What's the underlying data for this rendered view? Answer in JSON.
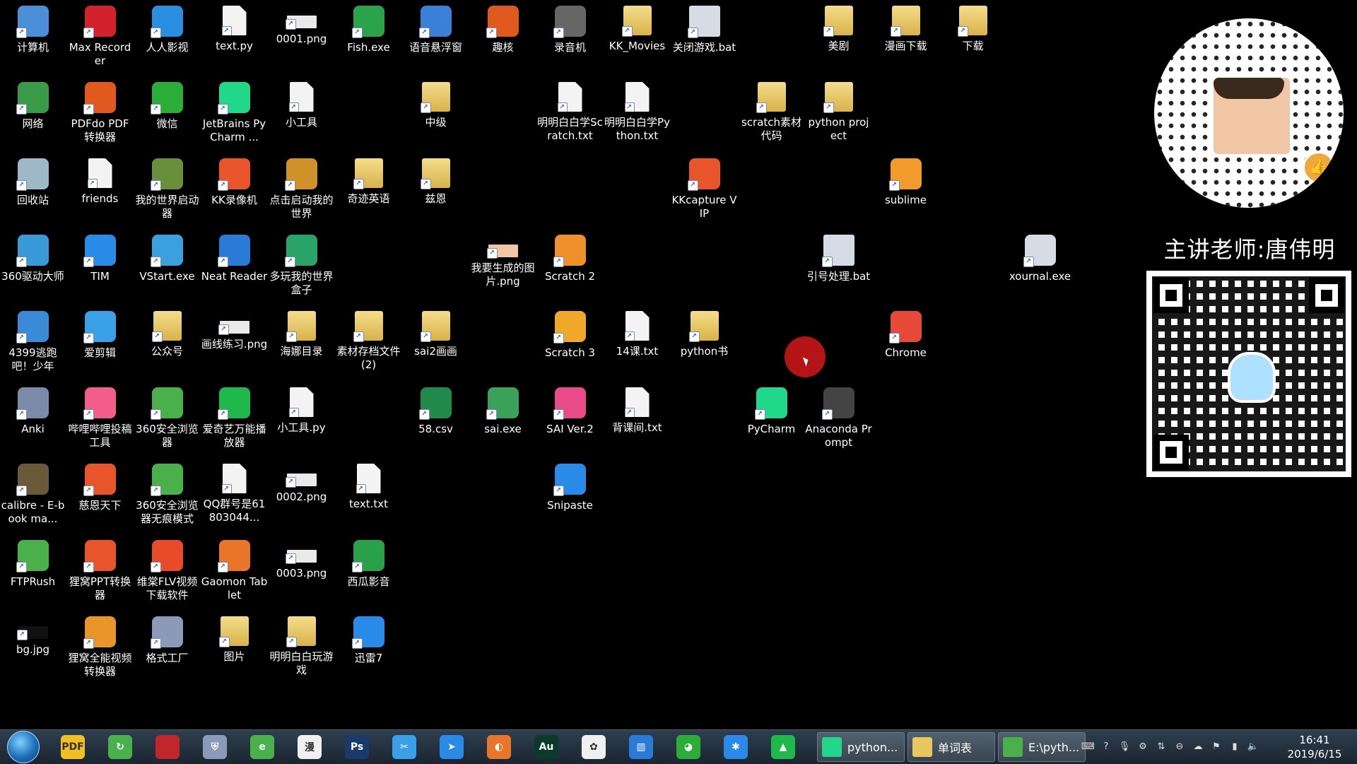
{
  "desktop": {
    "icons": [
      {
        "label": "计算机",
        "icon": "computer-icon",
        "color": "#4a8fd8"
      },
      {
        "label": "Max Recorder",
        "icon": "record-icon",
        "color": "#d2232a"
      },
      {
        "label": "人人影视",
        "icon": "video-icon",
        "color": "#2a8fe0"
      },
      {
        "label": "text.py",
        "icon": "python-file-icon",
        "color": "#f0f0f0"
      },
      {
        "label": "0001.png",
        "icon": "image-file-icon",
        "color": "#eaeaea"
      },
      {
        "label": "Fish.exe",
        "icon": "fish-icon",
        "color": "#2aa34a"
      },
      {
        "label": "语音悬浮窗",
        "icon": "voice-icon",
        "color": "#3a7fd8"
      },
      {
        "label": "趣核",
        "icon": "app-icon",
        "color": "#e05a20"
      },
      {
        "label": "录音机",
        "icon": "microphone-icon",
        "color": "#666666"
      },
      {
        "label": "KK_Movies",
        "icon": "folder-icon",
        "color": "#e8c660"
      },
      {
        "label": "关闭游戏.bat",
        "icon": "batch-file-icon",
        "color": "#d5dce6"
      },
      {
        "label": "美剧",
        "icon": "folder-icon",
        "color": "#e8c660"
      },
      {
        "label": "漫画下载",
        "icon": "folder-icon",
        "color": "#e8c660"
      },
      {
        "label": "下载",
        "icon": "folder-icon",
        "color": "#e8c660"
      },
      {
        "label": "网络",
        "icon": "network-icon",
        "color": "#3a9a4a"
      },
      {
        "label": "PDFdo PDF转换器",
        "icon": "pdf-icon",
        "color": "#e05a20"
      },
      {
        "label": "微信",
        "icon": "wechat-icon",
        "color": "#2aae38"
      },
      {
        "label": "JetBrains PyCharm ...",
        "icon": "pycharm-icon",
        "color": "#21d789"
      },
      {
        "label": "小工具",
        "icon": "file-icon",
        "color": "#f0f0f0"
      },
      {
        "label": "中级",
        "icon": "folder-icon",
        "color": "#e8c660"
      },
      {
        "label": "明明白白学Scratch.txt",
        "icon": "text-file-icon",
        "color": "#f0f0f0"
      },
      {
        "label": "明明白白学Python.txt",
        "icon": "text-file-icon",
        "color": "#f0f0f0"
      },
      {
        "label": "scratch素材代码",
        "icon": "folder-icon",
        "color": "#e8c660"
      },
      {
        "label": "python project",
        "icon": "folder-icon",
        "color": "#e8c660"
      },
      {
        "label": "回收站",
        "icon": "recycle-bin-icon",
        "color": "#9fb8c8"
      },
      {
        "label": "friends",
        "icon": "file-icon",
        "color": "#f0f0f0"
      },
      {
        "label": "我的世界启动器",
        "icon": "minecraft-icon",
        "color": "#6a8f3a"
      },
      {
        "label": "KK录像机",
        "icon": "kk-recorder-icon",
        "color": "#e8552a"
      },
      {
        "label": "点击启动我的世界",
        "icon": "minecraft-house-icon",
        "color": "#d0902a"
      },
      {
        "label": "奇迹英语",
        "icon": "folder-icon",
        "color": "#e8c660"
      },
      {
        "label": "兹恩",
        "icon": "folder-icon",
        "color": "#e8c660"
      },
      {
        "label": "KKcapture VIP",
        "icon": "kk-recorder-icon",
        "color": "#e8552a"
      },
      {
        "label": "sublime",
        "icon": "sublime-icon",
        "color": "#f29a2a"
      },
      {
        "label": "360驱动大师",
        "icon": "driver-icon",
        "color": "#3a9ad8"
      },
      {
        "label": "TIM",
        "icon": "tim-icon",
        "color": "#2a8ae8"
      },
      {
        "label": "VStart.exe",
        "icon": "vstart-icon",
        "color": "#3aa0e0"
      },
      {
        "label": "Neat Reader",
        "icon": "book-icon",
        "color": "#2a7ad8"
      },
      {
        "label": "多玩我的世界盒子",
        "icon": "box-icon",
        "color": "#2aa36a"
      },
      {
        "label": "我要生成的图片.png",
        "icon": "image-file-icon",
        "color": "#f1c6a4"
      },
      {
        "label": "Scratch 2",
        "icon": "scratch-cat-icon",
        "color": "#f0902a"
      },
      {
        "label": "引号处理.bat",
        "icon": "batch-file-icon",
        "color": "#d5dce6"
      },
      {
        "label": "xournal.exe",
        "icon": "xournal-icon",
        "color": "#d5dce6"
      },
      {
        "label": "4399逃跑吧！少年",
        "icon": "game-icon",
        "color": "#3a8ad8"
      },
      {
        "label": "爱剪辑",
        "icon": "video-edit-icon",
        "color": "#3aa0e8"
      },
      {
        "label": "公众号",
        "icon": "folder-icon",
        "color": "#e8c660"
      },
      {
        "label": "画线练习.png",
        "icon": "image-file-icon",
        "color": "#eaeaea"
      },
      {
        "label": "海娜目录",
        "icon": "folder-icon",
        "color": "#e8c660"
      },
      {
        "label": "素材存档文件(2)",
        "icon": "folder-icon",
        "color": "#e8c660"
      },
      {
        "label": "sai2画画",
        "icon": "folder-icon",
        "color": "#e8c660"
      },
      {
        "label": "Scratch 3",
        "icon": "scratch-icon",
        "color": "#f0a82a"
      },
      {
        "label": "14课.txt",
        "icon": "text-file-icon",
        "color": "#f0f0f0"
      },
      {
        "label": "python书",
        "icon": "folder-icon",
        "color": "#e8c660"
      },
      {
        "label": "Chrome",
        "icon": "chrome-icon",
        "color": "#e84a3a"
      },
      {
        "label": "Anki",
        "icon": "anki-icon",
        "color": "#7a8aa8"
      },
      {
        "label": "哔哩哔哩投稿工具",
        "icon": "bilibili-icon",
        "color": "#f25d8e"
      },
      {
        "label": "360安全浏览器",
        "icon": "browser-360-icon",
        "color": "#4ab04a"
      },
      {
        "label": "爱奇艺万能播放器",
        "icon": "iqiyi-icon",
        "color": "#1fb84a"
      },
      {
        "label": "小工具.py",
        "icon": "python-file-icon",
        "color": "#f0f0f0"
      },
      {
        "label": "58.csv",
        "icon": "excel-file-icon",
        "color": "#1f8a4a"
      },
      {
        "label": "sai.exe",
        "icon": "sai-icon",
        "color": "#3aa05a"
      },
      {
        "label": "SAI Ver.2",
        "icon": "sai2-icon",
        "color": "#e84a8a"
      },
      {
        "label": "背课间.txt",
        "icon": "text-file-icon",
        "color": "#f0f0f0"
      },
      {
        "label": "PyCharm",
        "icon": "pycharm-icon",
        "color": "#21d789"
      },
      {
        "label": "Anaconda Prompt",
        "icon": "terminal-icon",
        "color": "#444444"
      },
      {
        "label": "calibre - E-book ma...",
        "icon": "calibre-icon",
        "color": "#6a5a3a"
      },
      {
        "label": "慈恩天下",
        "icon": "app-icon",
        "color": "#e8552a"
      },
      {
        "label": "360安全浏览器无痕模式",
        "icon": "browser-360-icon",
        "color": "#4ab04a"
      },
      {
        "label": "QQ群号是61803044...",
        "icon": "file-icon",
        "color": "#f0f0f0"
      },
      {
        "label": "0002.png",
        "icon": "image-file-icon",
        "color": "#eaeaea"
      },
      {
        "label": "text.txt",
        "icon": "text-file-icon",
        "color": "#f0f0f0"
      },
      {
        "label": "Snipaste",
        "icon": "snipaste-icon",
        "color": "#2a8ae8"
      },
      {
        "label": "FTPRush",
        "icon": "ftp-icon",
        "color": "#4ab04a"
      },
      {
        "label": "狸窝PPT转换器",
        "icon": "ppt-converter-icon",
        "color": "#e8552a"
      },
      {
        "label": "维棠FLV视频下载软件",
        "icon": "download-icon",
        "color": "#e84a2a"
      },
      {
        "label": "Gaomon Tablet",
        "icon": "tablet-icon",
        "color": "#e8752a"
      },
      {
        "label": "0003.png",
        "icon": "image-file-icon",
        "color": "#eaeaea"
      },
      {
        "label": "西瓜影音",
        "icon": "player-icon",
        "color": "#2aa04a"
      },
      {
        "label": "bg.jpg",
        "icon": "image-file-icon",
        "color": "#111111"
      },
      {
        "label": "狸窝全能视频转换器",
        "icon": "video-converter-icon",
        "color": "#e8952a"
      },
      {
        "label": "格式工厂",
        "icon": "format-factory-icon",
        "color": "#8a9ab8"
      },
      {
        "label": "图片",
        "icon": "folder-icon",
        "color": "#e8c660"
      },
      {
        "label": "明明白白玩游戏",
        "icon": "folder-icon",
        "color": "#e8c660"
      },
      {
        "label": "迅雷7",
        "icon": "thunder-icon",
        "color": "#2a8ae8"
      }
    ]
  },
  "overlay": {
    "teacher": "主讲老师:唐伟明",
    "thumb_icon": "thumbs-up-icon",
    "penguin_icon": "qq-penguin-icon"
  },
  "taskbar": {
    "start_icon": "windows-start-icon",
    "pinned": [
      {
        "icon": "pdf-icon",
        "text": "PDF",
        "color": "#f0c020"
      },
      {
        "icon": "refresh-app-icon",
        "text": "↻",
        "color": "#4ab04a"
      },
      {
        "icon": "book-red-icon",
        "text": "",
        "color": "#c0262a"
      },
      {
        "icon": "shield-icon",
        "text": "⛨",
        "color": "#8a9ab8"
      },
      {
        "icon": "browser-360-icon",
        "text": "e",
        "color": "#4ab04a"
      },
      {
        "icon": "manga-icon",
        "text": "漫",
        "color": "#f0f0f0"
      },
      {
        "icon": "photoshop-icon",
        "text": "Ps",
        "color": "#1a3a6a"
      },
      {
        "icon": "video-edit-icon",
        "text": "✂",
        "color": "#3aa0e8"
      },
      {
        "icon": "thunder-icon",
        "text": "➤",
        "color": "#2a8ae8"
      },
      {
        "icon": "app-icon",
        "text": "◐",
        "color": "#e8752a"
      },
      {
        "icon": "audition-icon",
        "text": "Au",
        "color": "#0a3a2a"
      },
      {
        "icon": "photos-icon",
        "text": "✿",
        "color": "#f0f0f0"
      },
      {
        "icon": "book-icon",
        "text": "▥",
        "color": "#2a7ad8"
      },
      {
        "icon": "wechat-icon",
        "text": "◕",
        "color": "#2aae38"
      },
      {
        "icon": "tim-icon",
        "text": "✱",
        "color": "#2a8ae8"
      },
      {
        "icon": "iqiyi-icon",
        "text": "▲",
        "color": "#1fb84a"
      }
    ],
    "tasks": [
      {
        "label": "python...",
        "icon": "pycharm-icon",
        "color": "#21d789"
      },
      {
        "label": "单词表",
        "icon": "folder-icon",
        "color": "#e8c660"
      },
      {
        "label": "E:\\pyth...",
        "icon": "notepad-icon",
        "color": "#4ab04a"
      }
    ],
    "tray_icons": [
      "keyboard-icon",
      "help-icon",
      "microphone-icon",
      "settings-icon",
      "network-share-icon",
      "stop-icon",
      "cloud-icon",
      "flag-icon",
      "signal-icon",
      "volume-icon"
    ],
    "time": "16:41",
    "date": "2019/6/15"
  }
}
